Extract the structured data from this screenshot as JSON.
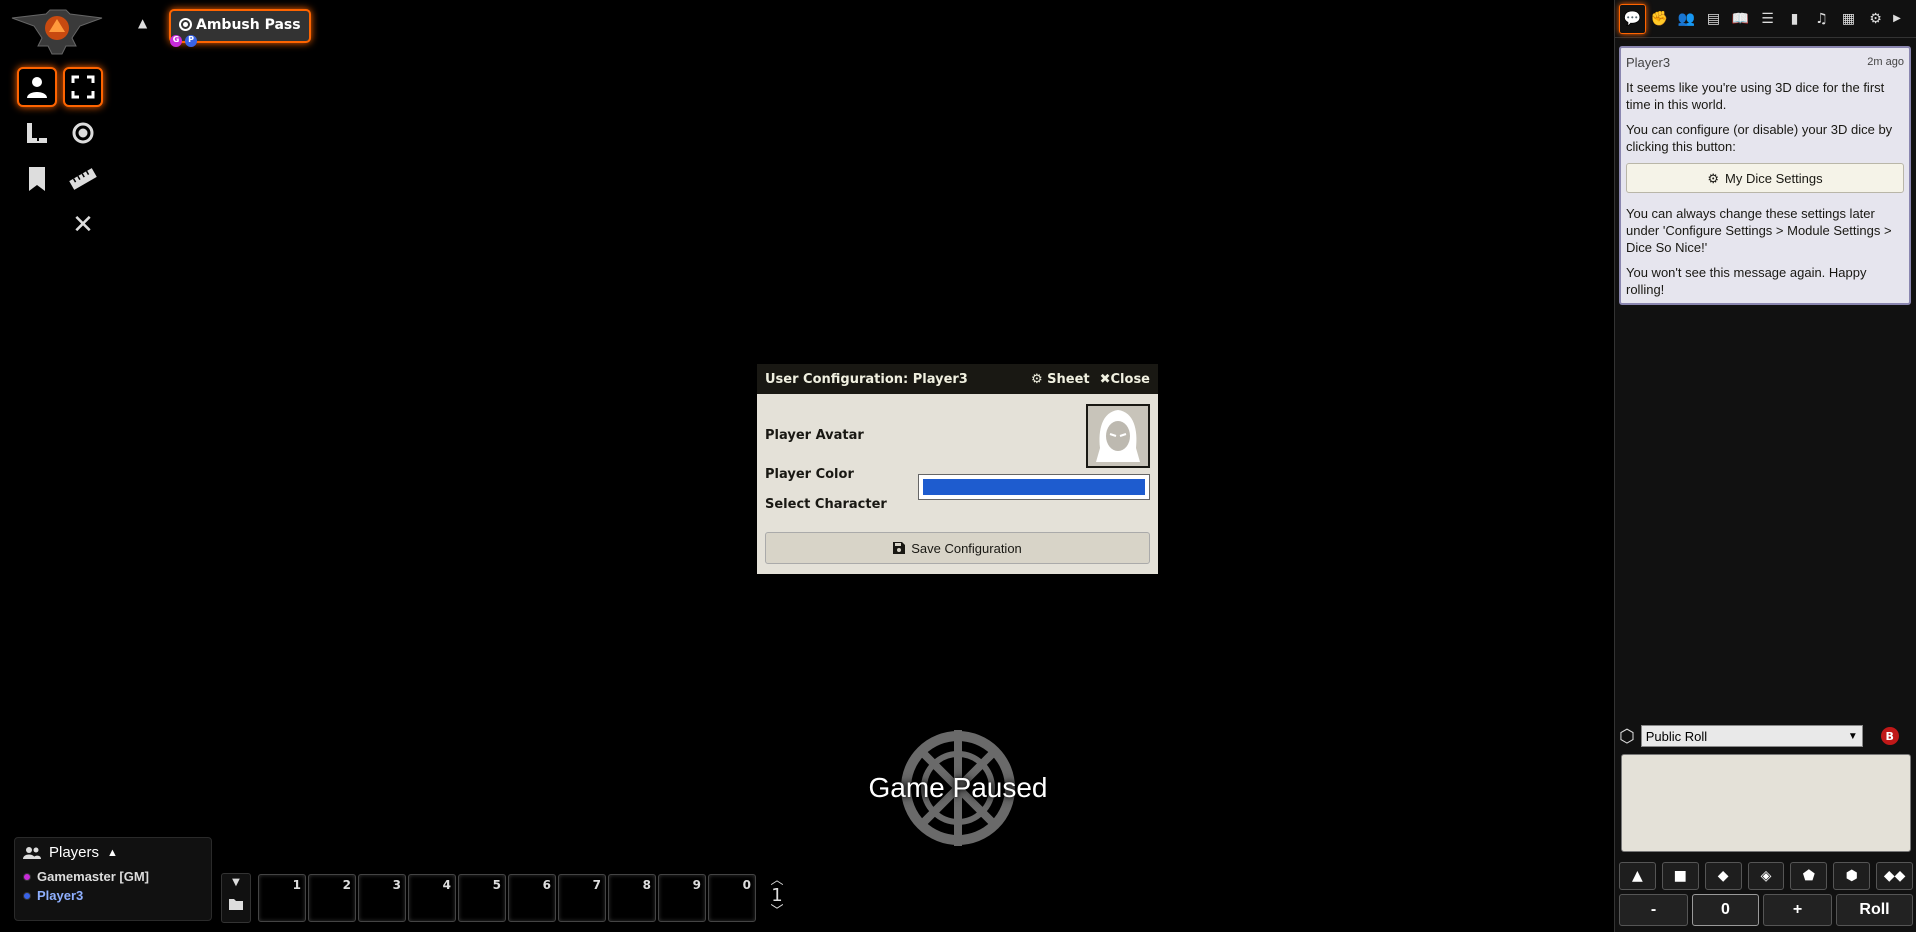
{
  "scene": {
    "name": "Ambush Pass",
    "pips": [
      "G",
      "P"
    ]
  },
  "controls": [
    "token-icon",
    "fullscreen-icon",
    "measure-icon",
    "target-icon",
    "bookmark-icon",
    "ruler-icon",
    "close-icon"
  ],
  "modal": {
    "title": "User Configuration: Player3",
    "sheet_label": "Sheet",
    "close_label": "Close",
    "avatar_label": "Player Avatar",
    "color_label": "Player Color",
    "player_color": "#1e5ccf",
    "character_label": "Select Character",
    "save_label": "Save Configuration"
  },
  "paused_text": "Game Paused",
  "players": {
    "header": "Players",
    "list": [
      {
        "name": "Gamemaster [GM]",
        "color": "#c82bd8"
      },
      {
        "name": "Player3",
        "color": "#3a64e8"
      }
    ]
  },
  "hotbar": {
    "slots": [
      "1",
      "2",
      "3",
      "4",
      "5",
      "6",
      "7",
      "8",
      "9",
      "0"
    ],
    "page": "1"
  },
  "chat": {
    "author": "Player3",
    "time": "2m ago",
    "p1": "It seems like you're using 3D dice for the first time in this world.",
    "p2": "You can configure (or disable) your 3D dice by clicking this button:",
    "button": "My Dice Settings",
    "p3": "You can always change these settings later under 'Configure Settings > Module Settings > Dice So Nice!'",
    "p4": "You won't see this message again. Happy rolling!"
  },
  "roll": {
    "mode": "Public Roll",
    "modifier_minus": "-",
    "modifier_value": "0",
    "modifier_plus": "+",
    "roll_label": "Roll"
  },
  "colors": {
    "accent": "#ff6400",
    "panel": "#191813",
    "parchment": "#e4e1d8"
  }
}
